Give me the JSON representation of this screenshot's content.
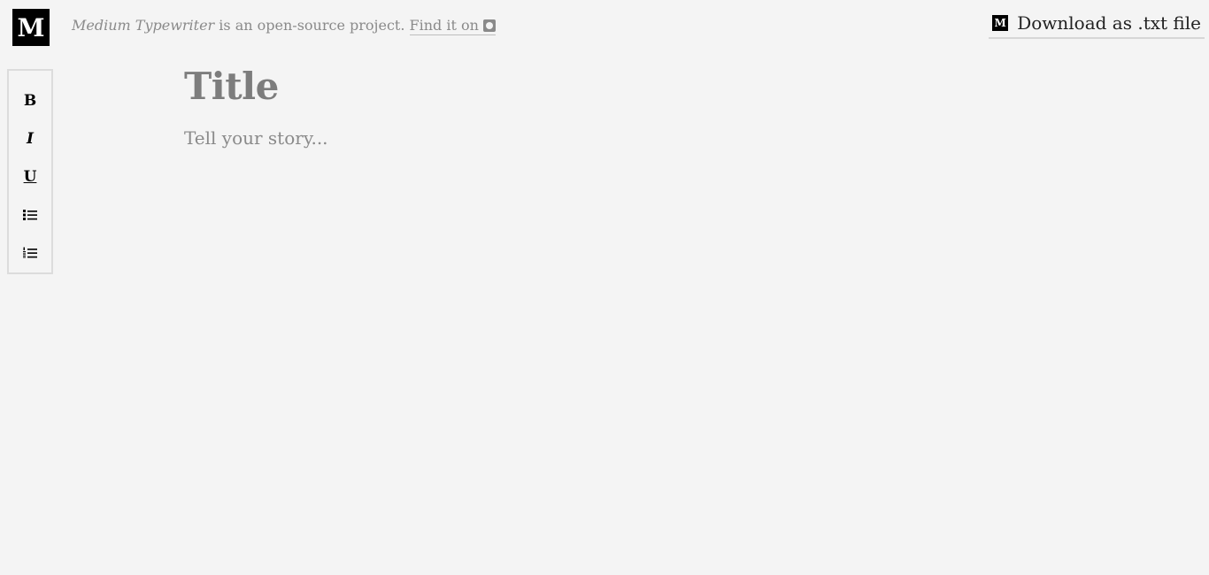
{
  "brand": {
    "logo_letter": "M"
  },
  "header": {
    "project_name": "Medium Typewriter",
    "tagline_rest": " is an open-source project. ",
    "find_link": "Find it on",
    "github_icon": "github-icon"
  },
  "download": {
    "icon_letter": "M",
    "label": "Download as .txt file"
  },
  "toolbar": {
    "items": [
      {
        "label": "B",
        "icon": "bold-icon"
      },
      {
        "label": "I",
        "icon": "italic-icon"
      },
      {
        "label": "U",
        "icon": "underline-icon"
      },
      {
        "label": "",
        "icon": "bullet-list-icon"
      },
      {
        "label": "",
        "icon": "numbered-list-icon"
      }
    ]
  },
  "editor": {
    "title_placeholder": "Title",
    "story_placeholder": "Tell your story..."
  }
}
